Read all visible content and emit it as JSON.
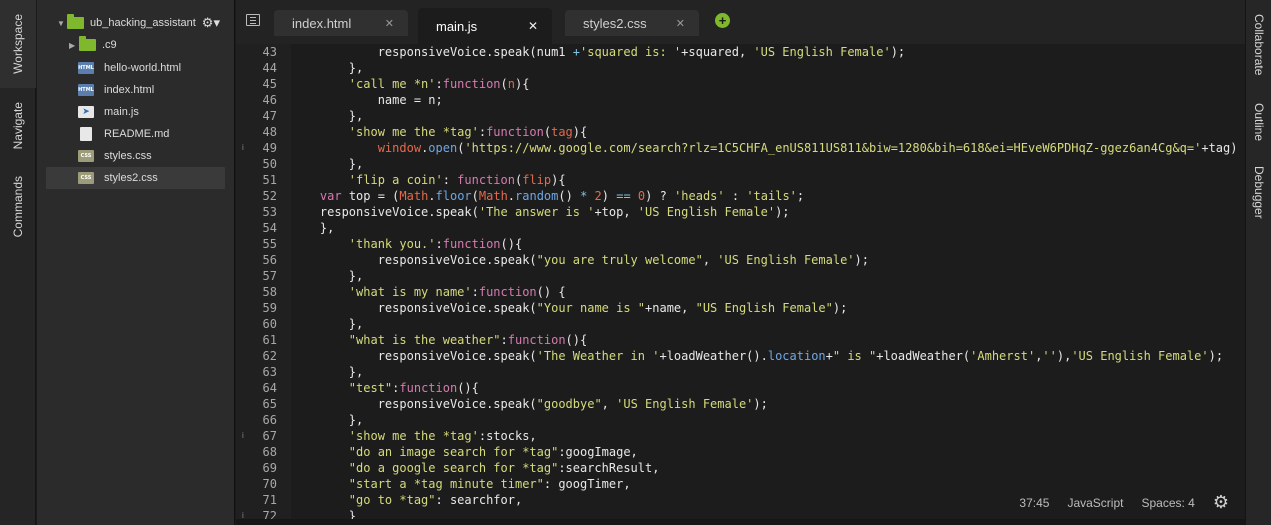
{
  "left_tabs": [
    "Workspace",
    "Navigate",
    "Commands"
  ],
  "right_tabs": [
    "Collaborate",
    "Outline",
    "Debugger"
  ],
  "tree": {
    "root": "ub_hacking_assistant",
    "items": [
      {
        "name": ".c9",
        "type": "folder"
      },
      {
        "name": "hello-world.html",
        "type": "html"
      },
      {
        "name": "index.html",
        "type": "html"
      },
      {
        "name": "main.js",
        "type": "js"
      },
      {
        "name": "README.md",
        "type": "md"
      },
      {
        "name": "styles.css",
        "type": "css"
      },
      {
        "name": "styles2.css",
        "type": "css"
      }
    ]
  },
  "tabs": [
    {
      "label": "index.html",
      "active": false
    },
    {
      "label": "main.js",
      "active": true
    },
    {
      "label": "styles2.css",
      "active": false
    }
  ],
  "add_tab": "+",
  "close_glyph": "✕",
  "editor": {
    "first_line": 43,
    "lines": [
      "            responsiveVoice.speak(num1 +'squared is: '+squared, 'US English Female');",
      "        },",
      "        'call me *n':function(n){",
      "            name = n;",
      "        },",
      "        'show me the *tag':function(tag){",
      "            window.open('https://www.google.com/search?rlz=1C5CHFA_enUS811US811&biw=1280&bih=618&ei=HEveW6PDHqZ-ggez6an4Cg&q='+tag)",
      "        },",
      "        'flip a coin': function(flip){",
      "    var top = (Math.floor(Math.random() * 2) == 0) ? 'heads' : 'tails';",
      "    responsiveVoice.speak('The answer is '+top, 'US English Female');",
      "    },",
      "        'thank you.':function(){",
      "            responsiveVoice.speak(\"you are truly welcome\", 'US English Female');",
      "        },",
      "        'what is my name':function() {",
      "            responsiveVoice.speak(\"Your name is \"+name, \"US English Female\");",
      "        },",
      "        \"what is the weather\":function(){",
      "            responsiveVoice.speak('The Weather in '+loadWeather().location+\" is \"+loadWeather('Amherst',''),'US English Female');",
      "        },",
      "        \"test\":function(){",
      "            responsiveVoice.speak(\"goodbye\", 'US English Female');",
      "        },",
      "        'show me the *tag':stocks,",
      "        \"do an image search for *tag\":googImage,",
      "        \"do a google search for *tag\":searchResult,",
      "        \"start a *tag minute timer\": googTimer,",
      "        \"go to *tag\": searchfor,",
      "        }"
    ],
    "warning_lines": [
      49,
      67,
      72
    ]
  },
  "status": {
    "position": "37:45",
    "language": "JavaScript",
    "spaces": "Spaces: 4"
  },
  "colors": {
    "string": "#d6db7a",
    "keyword": "#d77ab0",
    "accent": "#7fb82c"
  }
}
